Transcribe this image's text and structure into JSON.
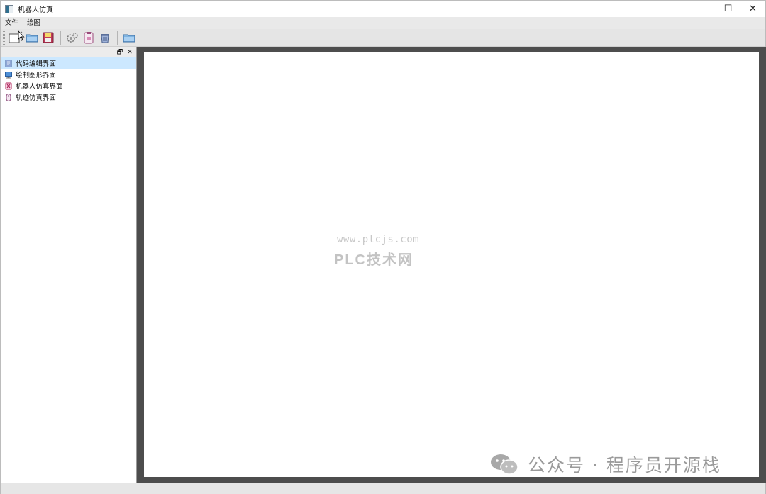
{
  "window": {
    "title": "机器人仿真",
    "controls": {
      "minimize": "—",
      "maximize": "☐",
      "close": "✕"
    }
  },
  "menubar": {
    "items": [
      "文件",
      "绘图"
    ]
  },
  "toolbar": {
    "buttons": [
      "new-file-icon",
      "open-folder-icon",
      "save-icon",
      "settings-gears-icon",
      "clipboard-icon",
      "trash-icon",
      "folder-icon"
    ]
  },
  "dock": {
    "float_glyph": "🗗",
    "close_glyph": "✕",
    "items": [
      {
        "label": "代码编辑界面",
        "icon": "document-icon",
        "selected": true
      },
      {
        "label": "绘制图形界面",
        "icon": "monitor-icon",
        "selected": false
      },
      {
        "label": "机器人仿真界面",
        "icon": "robot-icon",
        "selected": false
      },
      {
        "label": "轨迹仿真界面",
        "icon": "mouse-icon",
        "selected": false
      }
    ]
  },
  "watermark": {
    "url": "www.plcjs.com",
    "logo": "PLC技术网",
    "social": "公众号 · 程序员开源栈"
  },
  "colors": {
    "selection": "#cce8ff",
    "central_bg": "#4d4d4d",
    "canvas_bg": "#ffffff"
  }
}
